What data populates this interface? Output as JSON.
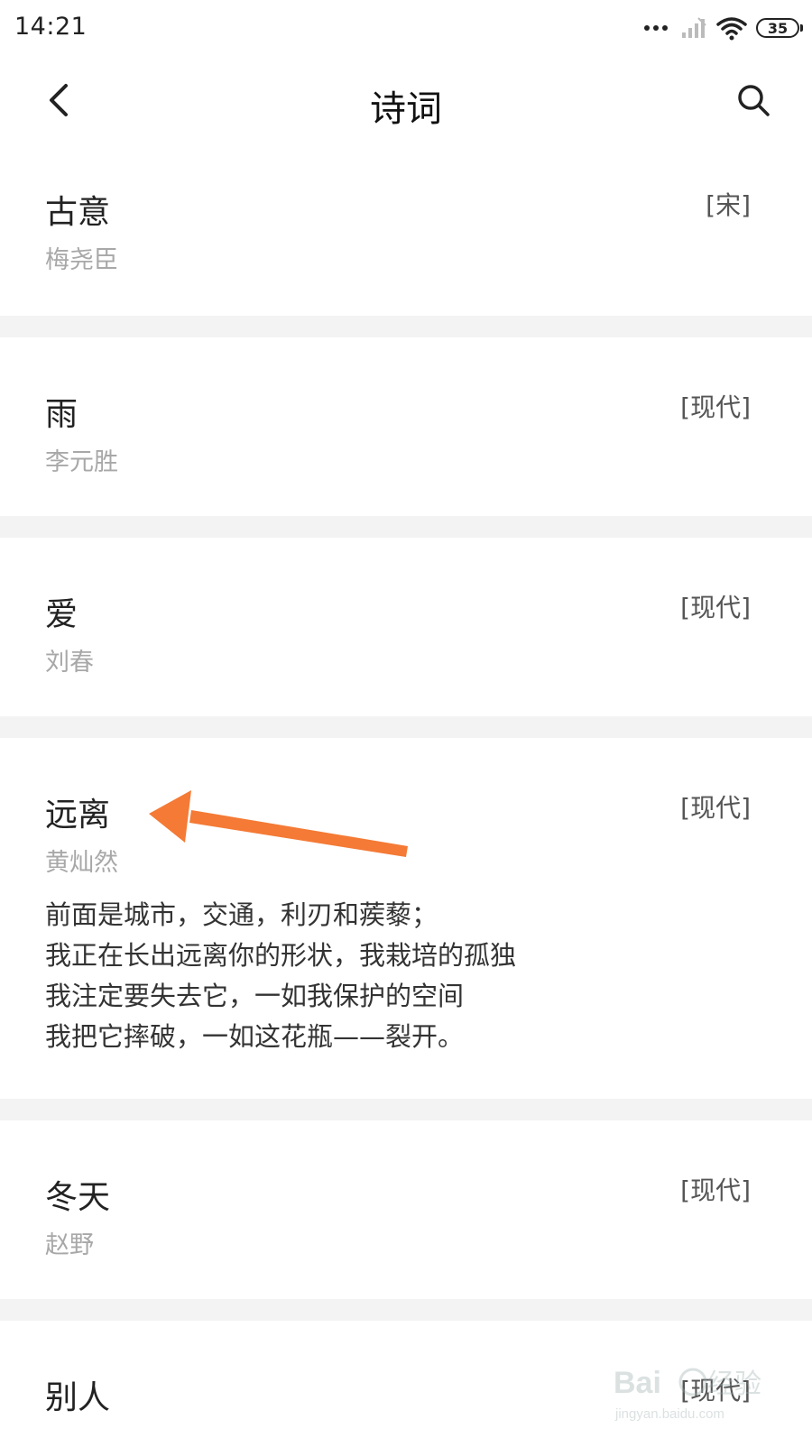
{
  "status_bar": {
    "time": "14:21",
    "battery": "35",
    "icons": [
      "more-dots-icon",
      "cellular-signal-icon",
      "wifi-icon",
      "battery-icon"
    ]
  },
  "header": {
    "title": "诗词",
    "back_icon": "chevron-left-icon",
    "search_icon": "search-icon"
  },
  "poems": [
    {
      "title": "古意",
      "author": "梅尧臣",
      "dynasty": "[宋]"
    },
    {
      "title": "雨",
      "author": "李元胜",
      "dynasty": "[现代]"
    },
    {
      "title": "爱",
      "author": "刘春",
      "dynasty": "[现代]"
    },
    {
      "title": "远离",
      "author": "黄灿然",
      "dynasty": "[现代]",
      "excerpt": [
        "前面是城市，交通，利刃和蒺藜；",
        "我正在长出远离你的形状，我栽培的孤独",
        "我注定要失去它，一如我保护的空间",
        "我把它摔破，一如这花瓶——裂开。"
      ]
    },
    {
      "title": "冬天",
      "author": "赵野",
      "dynasty": "[现代]"
    },
    {
      "title": "别人",
      "author": "",
      "dynasty": "[现代]"
    }
  ],
  "annotation": {
    "arrow_color": "#f47a35"
  },
  "watermark": {
    "text": "Baidu经验",
    "subtext": "jingyan.baidu.com"
  },
  "colors": {
    "divider": "#f3f3f3",
    "author_gray": "#a8a8a8"
  }
}
